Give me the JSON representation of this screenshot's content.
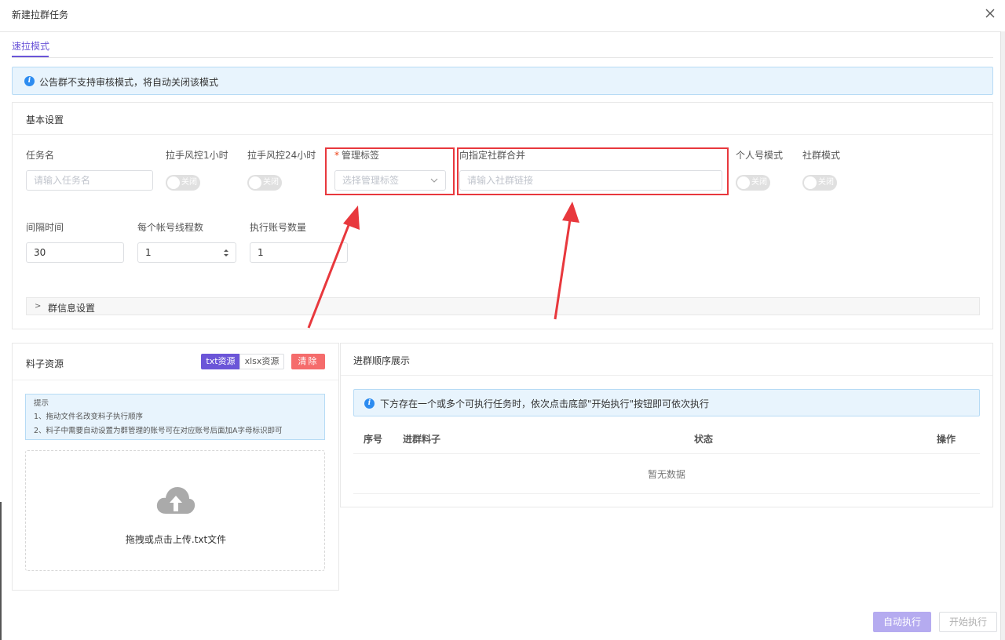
{
  "window": {
    "title": "新建拉群任务"
  },
  "tabs": [
    {
      "label": "速拉模式"
    }
  ],
  "notice": {
    "text": "公告群不支持审核模式，将自动关闭该模式"
  },
  "basic_settings": {
    "title": "基本设置",
    "fields": {
      "task_name": {
        "label": "任务名",
        "placeholder": "请输入任务名"
      },
      "risk_1h": {
        "label": "拉手风控1小时",
        "state": "关闭"
      },
      "risk_24h": {
        "label": "拉手风控24小时",
        "state": "关闭"
      },
      "manage_tag": {
        "required_mark": "*",
        "label": "管理标签",
        "placeholder": "选择管理标签"
      },
      "merge_group": {
        "label": "向指定社群合并",
        "placeholder": "请输入社群链接"
      },
      "personal_mode": {
        "label": "个人号模式",
        "state": "关闭"
      },
      "community_mode": {
        "label": "社群模式",
        "state": "关闭"
      },
      "interval": {
        "label": "间隔时间",
        "value": "30"
      },
      "threads": {
        "label": "每个帐号线程数",
        "value": "1"
      },
      "accounts": {
        "label": "执行账号数量",
        "value": "1"
      }
    },
    "group_info": {
      "label": "群信息设置"
    }
  },
  "materials": {
    "title": "料子资源",
    "btn_txt": "txt资源",
    "btn_xlsx": "xlsx资源",
    "btn_clear": "清除",
    "tips": {
      "title": "提示",
      "line1": "1、拖动文件名改变料子执行顺序",
      "line2": "2、料子中需要自动设置为群管理的账号可在对应账号后面加A字母标识即可"
    },
    "upload": {
      "text": "拖拽或点击上传.txt文件",
      "icon": "cloud-upload-icon"
    }
  },
  "order": {
    "title": "进群顺序展示",
    "notice": "下方存在一个或多个可执行任务时，依次点击底部\"开始执行\"按钮即可依次执行",
    "columns": [
      "序号",
      "进群料子",
      "状态",
      "操作"
    ],
    "empty": "暂无数据"
  },
  "footer": {
    "auto_exec": "自动执行",
    "start_exec": "开始执行"
  },
  "colors": {
    "accent": "#6b55d8",
    "danger": "#f56c6c",
    "annotation": "#e8383d",
    "info": "#2d8cf0"
  }
}
